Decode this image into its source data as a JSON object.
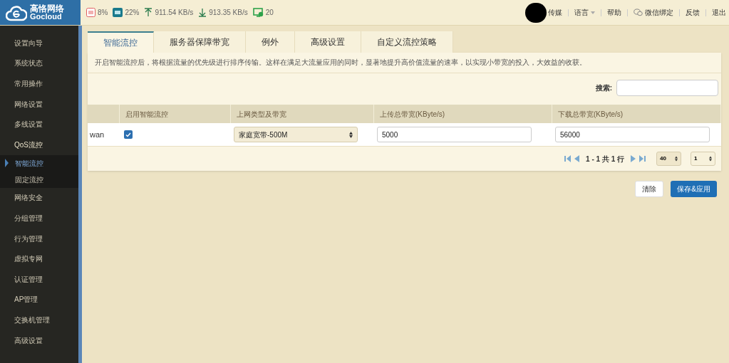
{
  "logo": {
    "name": "高恪网络",
    "brand": "Gocloud"
  },
  "stats": [
    {
      "kind": "cpu",
      "value": "8%"
    },
    {
      "kind": "ram",
      "value": "22%"
    },
    {
      "kind": "up",
      "value": "911.54 KB/s"
    },
    {
      "kind": "down",
      "value": "913.35 KB/s"
    },
    {
      "kind": "clients",
      "value": "20"
    }
  ],
  "top_links": [
    {
      "kind": "user",
      "label": "传媒"
    },
    {
      "kind": "dropdown",
      "label": "语言"
    },
    {
      "kind": "plain",
      "label": "帮助"
    },
    {
      "kind": "wechat",
      "label": "微信绑定"
    },
    {
      "kind": "plain",
      "label": "反馈"
    },
    {
      "kind": "plain",
      "label": "退出"
    }
  ],
  "sidebar": {
    "items": [
      {
        "label": "设置向导",
        "expanded": false
      },
      {
        "label": "系统状态",
        "expanded": false
      },
      {
        "label": "常用操作",
        "expanded": false
      },
      {
        "label": "网络设置",
        "expanded": false
      },
      {
        "label": "多线设置",
        "expanded": false
      },
      {
        "label": "QoS流控",
        "expanded": true,
        "children": [
          {
            "label": "智能流控",
            "selected": true
          },
          {
            "label": "固定流控",
            "selected": false
          }
        ]
      },
      {
        "label": "网络安全",
        "expanded": false
      },
      {
        "label": "分组管理",
        "expanded": false
      },
      {
        "label": "行为管理",
        "expanded": false
      },
      {
        "label": "虚拟专网",
        "expanded": false
      },
      {
        "label": "认证管理",
        "expanded": false
      },
      {
        "label": "AP管理",
        "expanded": false
      },
      {
        "label": "交换机管理",
        "expanded": false
      },
      {
        "label": "高级设置",
        "expanded": false
      }
    ]
  },
  "tabs": [
    {
      "label": "智能流控",
      "selected": true
    },
    {
      "label": "服务器保障带宽",
      "selected": false
    },
    {
      "label": "例外",
      "selected": false
    },
    {
      "label": "高级设置",
      "selected": false
    },
    {
      "label": "自定义流控策略",
      "selected": false
    }
  ],
  "description": "开启智能流控后，将根据流量的优先级进行排序传输。这样在满足大流量应用的同时，显著地提升高价值流量的速率，以实现小带宽的投入，大效益的收获。",
  "search": {
    "label": "搜索:"
  },
  "table": {
    "columns": [
      "启用智能流控",
      "上网类型及带宽",
      "上传总带宽(KByte/s)",
      "下载总带宽(KByte/s)"
    ],
    "rows": [
      {
        "name": "wan",
        "enabled": true,
        "type": "家庭宽带-500M",
        "upload": "5000",
        "download": "56000"
      }
    ]
  },
  "pager": {
    "summary": "1 - 1 共 1 行",
    "page_size": "40",
    "page": "1"
  },
  "buttons": [
    {
      "kind": "secondary",
      "label": "清除"
    },
    {
      "kind": "primary",
      "label": "保存&应用"
    }
  ]
}
